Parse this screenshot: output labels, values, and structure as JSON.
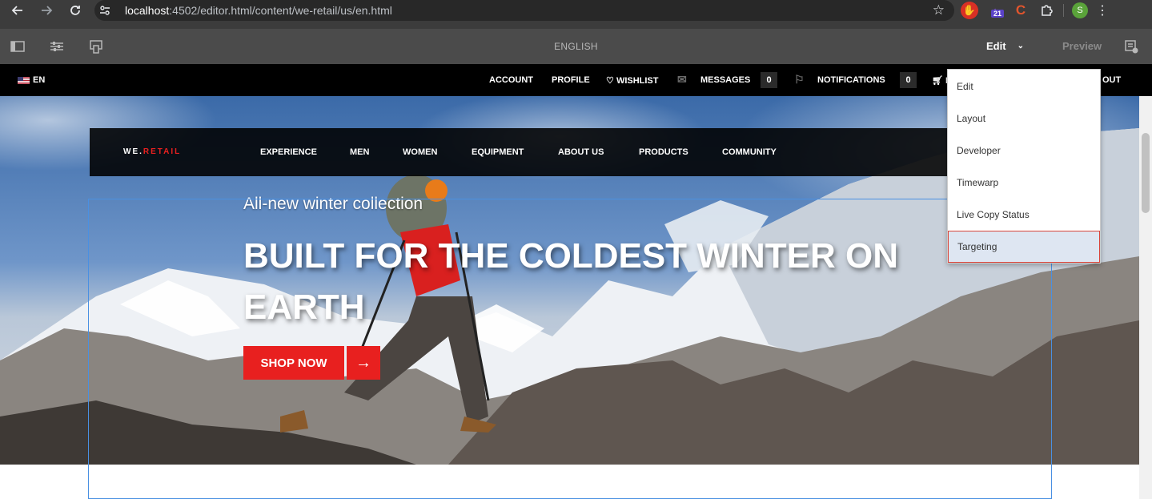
{
  "browser": {
    "url_host": "localhost",
    "url_path": ":4502/editor.html/content/we-retail/us/en.html",
    "ext_badge": "21",
    "ext_c": "C",
    "profile_initial": "S"
  },
  "editor": {
    "page_title": "ENGLISH",
    "mode_label": "Edit",
    "preview_label": "Preview"
  },
  "utility": {
    "language": "EN",
    "account": "ACCOUNT",
    "profile": "PROFILE",
    "wishlist": "WISHLIST",
    "messages": "MESSAGES",
    "messages_count": "0",
    "notifications": "NOTIFICATIONS",
    "notifications_count": "0",
    "cart_partial": "M",
    "logout_partial": "OUT"
  },
  "site_nav": {
    "brand_prefix": "WE.",
    "brand_suffix": "RETAIL",
    "links": [
      "EXPERIENCE",
      "MEN",
      "WOMEN",
      "EQUIPMENT",
      "ABOUT US",
      "PRODUCTS",
      "COMMUNITY"
    ]
  },
  "hero": {
    "subtitle": "All-new winter collection",
    "title": "BUILT FOR THE COLDEST WINTER ON EARTH",
    "cta_label": "SHOP NOW",
    "cta_arrow": "→"
  },
  "mode_menu": {
    "items": [
      "Edit",
      "Layout",
      "Developer",
      "Timewarp",
      "Live Copy Status",
      "Targeting"
    ],
    "selected": "Targeting"
  },
  "colors": {
    "accent_red": "#e8201f",
    "toolbar_gray": "#4b4b4b",
    "selection_blue": "#4a90e2"
  }
}
